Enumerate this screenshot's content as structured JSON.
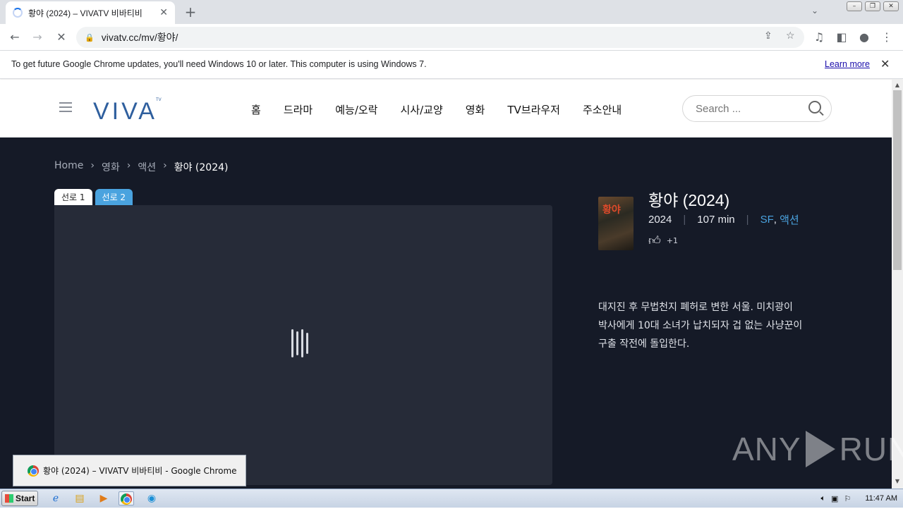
{
  "browser": {
    "tab_title": "황야 (2024) – VIVATV 비바티비",
    "url": "vivatv.cc/mv/황야/",
    "infobar_message": "To get future Google Chrome updates, you'll need Windows 10 or later. This computer is using Windows 7.",
    "infobar_link": "Learn more"
  },
  "site": {
    "logo": "VIVA",
    "logo_tv": "TV",
    "nav": [
      "홈",
      "드라마",
      "예능/오락",
      "시사/교양",
      "영화",
      "TV브라우저",
      "주소안내"
    ],
    "search_placeholder": "Search ..."
  },
  "breadcrumb": [
    "Home",
    "영화",
    "액션",
    "황야 (2024)"
  ],
  "sources": [
    "선로 1",
    "선로 2"
  ],
  "movie": {
    "poster_text": "황야",
    "title": "황야 (2024)",
    "year": "2024",
    "runtime": "107 min",
    "genre1": "SF",
    "genre2": "액션",
    "likes": "+1",
    "description": "대지진 후 무법천지 폐허로 변한 서울. 미치광이 박사에게 10대 소녀가 납치되자 겁 없는 사냥꾼이 구출 작전에 돌입한다."
  },
  "watermark": {
    "left": "ANY",
    "right": "RUN"
  },
  "taskbar": {
    "popup_title": "황야 (2024) – VIVATV 비바티비 - Google Chrome",
    "start": "Start",
    "clock": "11:47 AM"
  }
}
